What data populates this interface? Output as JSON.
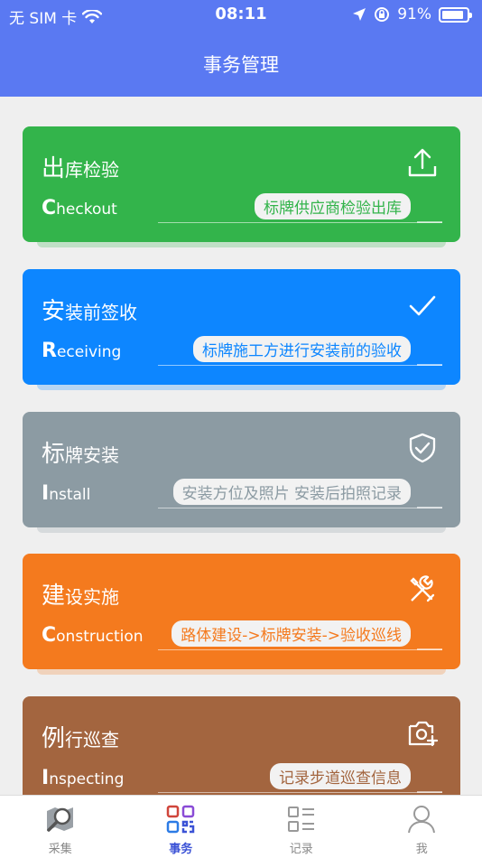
{
  "status": {
    "carrier": "无 SIM 卡",
    "time": "08:11",
    "battery": "91%"
  },
  "header": {
    "title": "事务管理"
  },
  "cards": [
    {
      "title_first": "出",
      "title_rest": "库检验",
      "en_first": "C",
      "en_rest": "heckout",
      "tag": "标牌供应商检验出库",
      "color": "#33b44b",
      "tag_color": "#33b44b",
      "icon": "upload-icon"
    },
    {
      "title_first": "安",
      "title_rest": "装前签收",
      "en_first": "R",
      "en_rest": "eceiving",
      "tag": "标牌施工方进行安装前的验收",
      "color": "#0d86ff",
      "tag_color": "#0d86ff",
      "icon": "check-icon"
    },
    {
      "title_first": "标",
      "title_rest": "牌安装",
      "en_first": "I",
      "en_rest": "nstall",
      "tag": "安装方位及照片 安装后拍照记录",
      "color": "#8c9ba3",
      "tag_color": "#8c9ba3",
      "icon": "shield-check-icon"
    },
    {
      "title_first": "建",
      "title_rest": "设实施",
      "en_first": "C",
      "en_rest": "onstruction",
      "tag": "路体建设->标牌安装->验收巡线",
      "color": "#f47a1e",
      "tag_color": "#f47a1e",
      "icon": "tools-icon"
    },
    {
      "title_first": "例",
      "title_rest": "行巡查",
      "en_first": "I",
      "en_rest": "nspecting",
      "tag": "记录步道巡查信息",
      "color": "#a3653f",
      "tag_color": "#a3653f",
      "icon": "camera-add-icon"
    }
  ],
  "tabs": [
    {
      "label": "采集",
      "icon": "map-search-icon"
    },
    {
      "label": "事务",
      "icon": "qrcode-icon",
      "active": true
    },
    {
      "label": "记录",
      "icon": "list-icon"
    },
    {
      "label": "我",
      "icon": "user-icon"
    }
  ]
}
